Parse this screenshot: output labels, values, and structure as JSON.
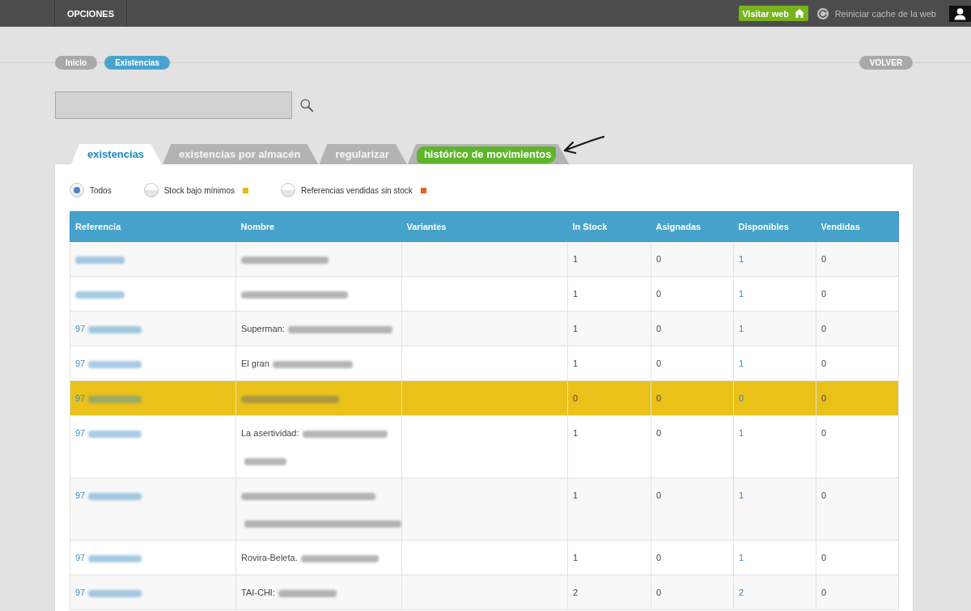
{
  "top_bar": {
    "menu_item": "OPCIONES",
    "visit_button": "Visitar web",
    "cache_link": "Reiniciar cache de la web"
  },
  "breadcrumbs": [
    {
      "label": "Inicio",
      "selected": false
    },
    {
      "label": "Existencias",
      "selected": true
    }
  ],
  "back_button": "VOLVER",
  "tabs": [
    {
      "label": "existencias",
      "selected": true,
      "highlighted": false
    },
    {
      "label": "existencias por almacén",
      "selected": false,
      "highlighted": false
    },
    {
      "label": "regularizar",
      "selected": false,
      "highlighted": false
    },
    {
      "label": "histórico de movimientos",
      "selected": false,
      "highlighted": true
    }
  ],
  "filters": [
    {
      "label": "Todos",
      "selected": true
    },
    {
      "label": "Stock bajo mínimos",
      "selected": false,
      "color": "#e8b90c"
    },
    {
      "label": "Referencias vendidas sin stock",
      "selected": false,
      "color": "#e8631e"
    }
  ],
  "table": {
    "columns": [
      "Referencia",
      "Nombre",
      "Variantes",
      "In Stock",
      "Asignadas",
      "Disponibles",
      "Vendidas"
    ],
    "rows": [
      {
        "highlighted": false,
        "reference": {
          "redacted": true
        },
        "name": {
          "redacted": true
        },
        "in_stock": "1",
        "assigned": "0",
        "available": "1",
        "sold": "0"
      },
      {
        "highlighted": false,
        "reference": {
          "redacted": true
        },
        "name": {
          "redacted": true
        },
        "in_stock": "1",
        "assigned": "0",
        "available": "1",
        "sold": "0"
      },
      {
        "highlighted": false,
        "reference": {
          "text": "97",
          "redacted": true
        },
        "name": {
          "text": "Superman:",
          "redacted": true
        },
        "in_stock": "1",
        "assigned": "0",
        "available": "1",
        "sold": "0"
      },
      {
        "highlighted": false,
        "reference": {
          "text": "97",
          "redacted": true
        },
        "name": {
          "text": "El gran",
          "redacted": true
        },
        "in_stock": "1",
        "assigned": "0",
        "available": "1",
        "sold": "0"
      },
      {
        "highlighted": true,
        "reference": {
          "text": "97",
          "redacted": true
        },
        "name": {
          "redacted": true
        },
        "in_stock": "0",
        "assigned": "0",
        "available": "0",
        "sold": "0"
      },
      {
        "highlighted": false,
        "reference": {
          "text": "97",
          "redacted": true
        },
        "name": {
          "text": "La asertividad:",
          "redacted": true
        },
        "in_stock": "1",
        "assigned": "0",
        "available": "1",
        "sold": "0"
      },
      {
        "highlighted": false,
        "reference": {
          "text": "97",
          "redacted": true
        },
        "name": {
          "redacted": true
        },
        "in_stock": "1",
        "assigned": "0",
        "available": "1",
        "sold": "0"
      },
      {
        "highlighted": false,
        "reference": {
          "text": "97",
          "redacted": true
        },
        "name": {
          "text": "Rovira-Beleta.",
          "redacted": true
        },
        "in_stock": "1",
        "assigned": "0",
        "available": "1",
        "sold": "0"
      },
      {
        "highlighted": false,
        "reference": {
          "text": "97",
          "redacted": true
        },
        "name": {
          "text": "TAI-CHI:",
          "redacted": true
        },
        "in_stock": "2",
        "assigned": "0",
        "available": "2",
        "sold": "0"
      }
    ]
  }
}
